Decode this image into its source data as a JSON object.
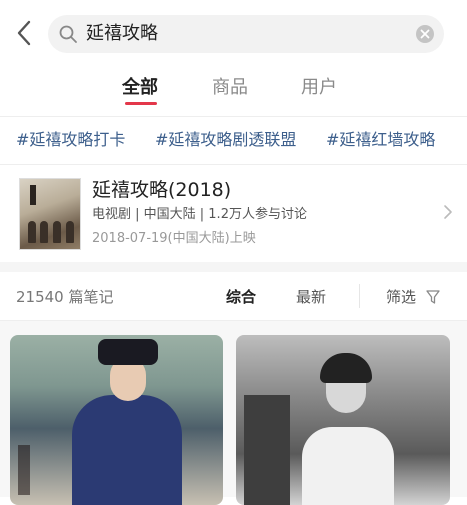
{
  "search": {
    "query": "延禧攻略"
  },
  "tabs": [
    "全部",
    "商品",
    "用户"
  ],
  "active_tab": "全部",
  "tags": [
    "#延禧攻略打卡",
    "#延禧攻略剧透联盟",
    "#延禧红墙攻略"
  ],
  "card": {
    "title": "延禧攻略(2018)",
    "meta": "电视剧 | 中国大陆 | 1.2万人参与讨论",
    "date": "2018-07-19(中国大陆)上映"
  },
  "filter": {
    "count": "21540 篇笔记",
    "sort_options": [
      "综合",
      "最新"
    ],
    "active_sort": "综合",
    "filter_label": "筛选"
  },
  "notes": [
    {
      "caption_visible": false
    },
    {
      "caption_visible": false
    }
  ],
  "colors": {
    "accent": "#e3374a",
    "tag": "#3d5f8c"
  }
}
